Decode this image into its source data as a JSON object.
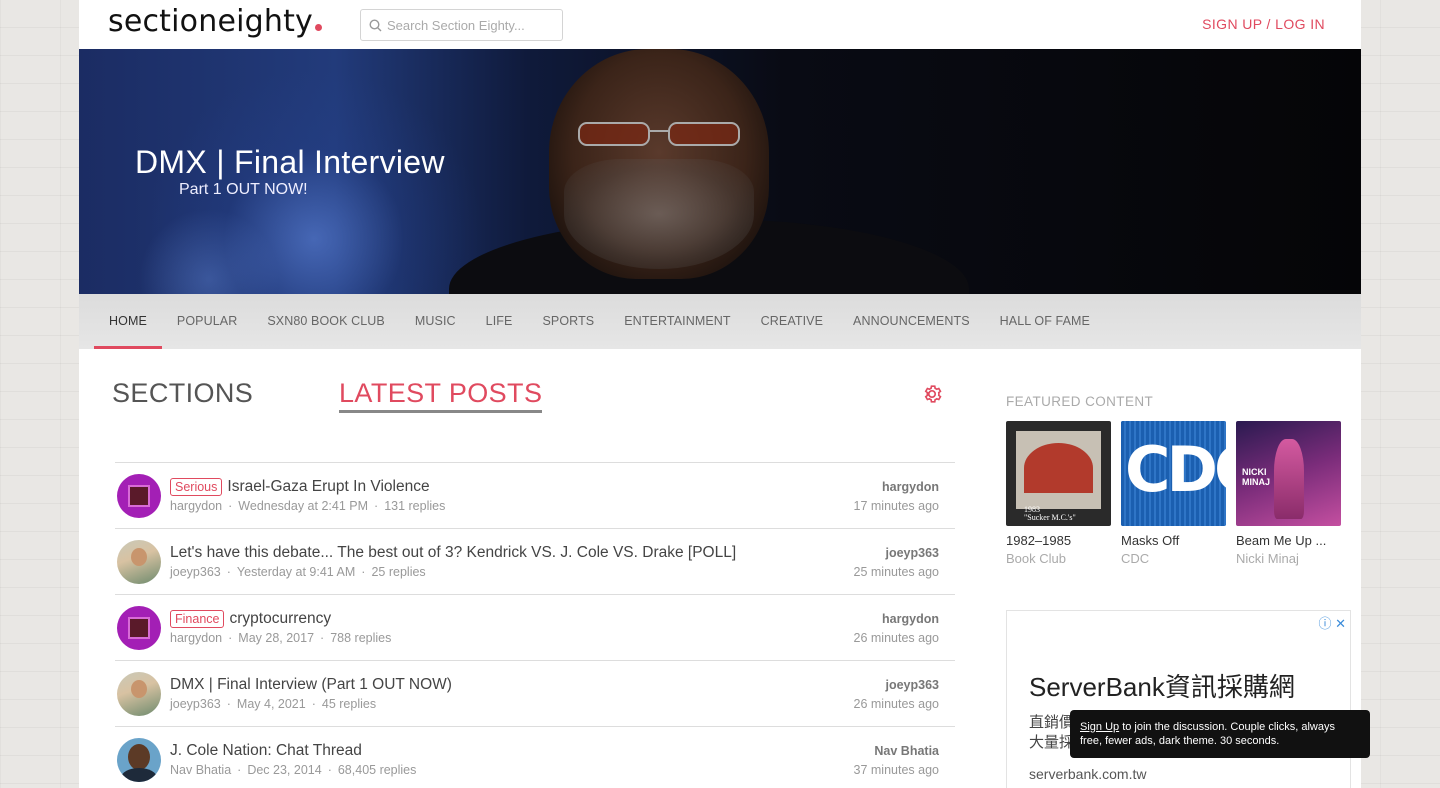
{
  "header": {
    "logo_text": "sectioneighty",
    "search_placeholder": "Search Section Eighty...",
    "signup_label": "SIGN UP / LOG IN"
  },
  "hero": {
    "title": "DMX | Final Interview",
    "subtitle": "Part 1 OUT NOW!"
  },
  "nav": {
    "items": [
      "HOME",
      "POPULAR",
      "SXN80 BOOK CLUB",
      "MUSIC",
      "LIFE",
      "SPORTS",
      "ENTERTAINMENT",
      "CREATIVE",
      "ANNOUNCEMENTS",
      "HALL OF FAME"
    ],
    "active": "HOME"
  },
  "tabs": {
    "sections": "SECTIONS",
    "latest": "LATEST POSTS"
  },
  "posts": [
    {
      "tag": "Serious",
      "title": "Israel-Gaza Erupt In Violence",
      "author": "hargydon",
      "date": "Wednesday at 2:41 PM",
      "replies": "131 replies",
      "last_user": "hargydon",
      "last_time": "17 minutes ago"
    },
    {
      "tag": "",
      "title": "Let's have this debate... The best out of 3? Kendrick VS. J. Cole VS. Drake [POLL]",
      "author": "joeyp363",
      "date": "Yesterday at 9:41 AM",
      "replies": "25 replies",
      "last_user": "joeyp363",
      "last_time": "25 minutes ago"
    },
    {
      "tag": "Finance",
      "title": "cryptocurrency",
      "author": "hargydon",
      "date": "May 28, 2017",
      "replies": "788 replies",
      "last_user": "hargydon",
      "last_time": "26 minutes ago"
    },
    {
      "tag": "",
      "title": "DMX | Final Interview (Part 1 OUT NOW)",
      "author": "joeyp363",
      "date": "May 4, 2021",
      "replies": "45 replies",
      "last_user": "joeyp363",
      "last_time": "26 minutes ago"
    },
    {
      "tag": "",
      "title": "J. Cole Nation: Chat Thread",
      "author": "Nav Bhatia",
      "date": "Dec 23, 2014",
      "replies": "68,405 replies",
      "last_user": "Nav Bhatia",
      "last_time": "37 minutes ago"
    }
  ],
  "featured": {
    "heading": "FEATURED CONTENT",
    "items": [
      {
        "title": "1982–1985",
        "sub": "Book Club",
        "art_text": "1983\n\"Sucker M.C.'s\""
      },
      {
        "title": "Masks Off",
        "sub": "CDC",
        "art_text": "CDC"
      },
      {
        "title": "Beam Me Up ...",
        "sub": "Nicki Minaj",
        "art_text": "NICKI MINAJ"
      }
    ]
  },
  "ad": {
    "title": "ServerBank資訊採購網",
    "text_line1": "直銷價",
    "text_line2": "大量採",
    "url": "serverbank.com.tw",
    "icons": "ⓘ ✕"
  },
  "toast": {
    "link": "Sign Up",
    "text": " to join the discussion. Couple clicks, always free, fewer ads, dark theme. 30 seconds."
  },
  "colors": {
    "accent": "#e04a5f",
    "nav_bg": "#dcdcdc"
  }
}
